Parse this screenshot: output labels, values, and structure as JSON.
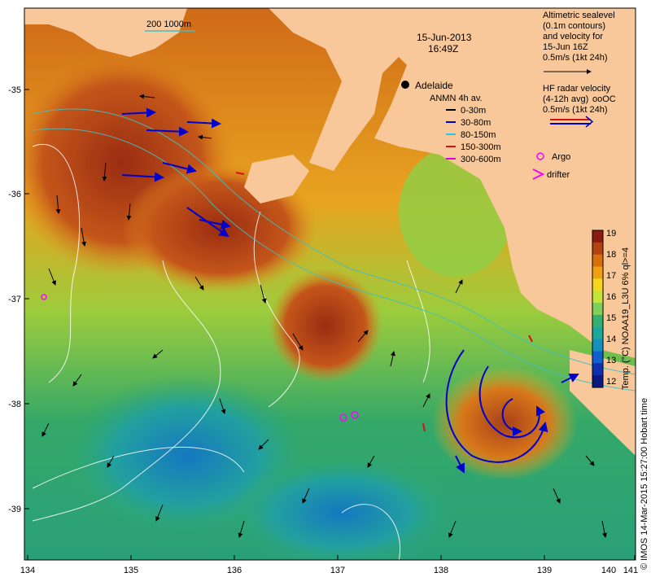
{
  "map": {
    "date": "15-Jun-2013",
    "time": "16:49Z",
    "scale_label": "200  1000m",
    "city": "Adelaide",
    "longitude_ticks": [
      "134",
      "135",
      "136",
      "137",
      "138",
      "139",
      "140",
      "141"
    ],
    "latitude_ticks": [
      "-35",
      "-36",
      "-37",
      "-38",
      "-39"
    ],
    "lon_range": [
      134,
      141.3
    ],
    "lat_range": [
      -39.5,
      -34.1
    ]
  },
  "altimetry_legend": {
    "line1": "Altimetric sealevel",
    "line2": "(0.1m contours)",
    "line3": "and velocity for",
    "line4": "15-Jun 16Z",
    "line5": "0.5m/s (1kt 24h)"
  },
  "radar_legend": {
    "line1": "HF radar velocity",
    "line2": "(4-12h avg)",
    "line2b": "ooOC",
    "line3": "0.5m/s (1kt 24h)"
  },
  "anmn_legend": {
    "title": "ANMN 4h av.",
    "items": [
      {
        "label": "0-30m",
        "color": "#000000"
      },
      {
        "label": "30-80m",
        "color": "#0000cc"
      },
      {
        "label": "80-150m",
        "color": "#22c8e8"
      },
      {
        "label": "150-300m",
        "color": "#d81010"
      },
      {
        "label": "300-600m",
        "color": "#e000e0"
      }
    ]
  },
  "markers": {
    "argo_label": "Argo",
    "drifter_label": "drifter",
    "argo_color": "#ff00ff",
    "drifter_color": "#ff00ff"
  },
  "colorbar": {
    "label": "Temp. (°C) NOAA19_L3U 6% ql>=4",
    "ticks": [
      "19",
      "18",
      "17",
      "16",
      "15",
      "14",
      "13",
      "12"
    ],
    "colors": [
      "#8b1a10",
      "#b5420e",
      "#d8700a",
      "#f0a010",
      "#f4d81c",
      "#c4e43a",
      "#7ed058",
      "#34b070",
      "#1aa89a",
      "#1490c0",
      "#1060d0",
      "#1030b0",
      "#0a1a80"
    ]
  },
  "credit": "© IMOS 14-Mar-2015 15:27:00 Hobart time",
  "colors": {
    "land": "#f8c89a",
    "warm": "#c0581a",
    "ocean_cool": "#3aa860"
  }
}
